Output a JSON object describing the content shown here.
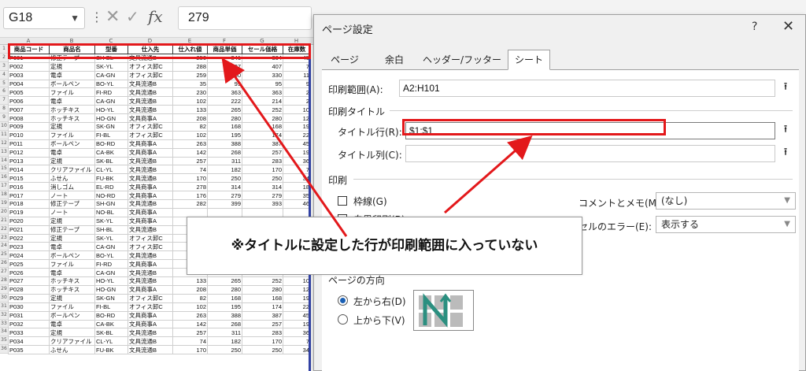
{
  "formula_bar": {
    "cell_ref": "G18",
    "value": "279",
    "fx": "fx"
  },
  "sheet": {
    "columns": [
      "A",
      "B",
      "C",
      "D",
      "E",
      "F",
      "G",
      "H"
    ],
    "headers": [
      "商品コード",
      "商品名",
      "型番",
      "仕入先",
      "仕入れ値",
      "商品単価",
      "セール価格",
      "在庫数"
    ],
    "rows": [
      [
        "P001",
        "修正テープ",
        "SH-BL",
        "文具流通B",
        "250",
        "341",
        "304",
        "45"
      ],
      [
        "P002",
        "定規",
        "SK-YL",
        "オフィス卸C",
        "288",
        "407",
        "407",
        "7"
      ],
      [
        "P003",
        "電卓",
        "CA-GN",
        "オフィス卸C",
        "259",
        "330",
        "330",
        "11"
      ],
      [
        "P004",
        "ボールペン",
        "BO-YL",
        "文具流通B",
        "35",
        "95",
        "95",
        "9"
      ],
      [
        "P005",
        "ファイル",
        "FI-RD",
        "文具流通B",
        "230",
        "363",
        "363",
        "2"
      ],
      [
        "P006",
        "電卓",
        "CA-GN",
        "文具流通B",
        "102",
        "222",
        "214",
        "2"
      ],
      [
        "P007",
        "ホッチキス",
        "HO-YL",
        "文具流通B",
        "133",
        "265",
        "252",
        "10"
      ],
      [
        "P008",
        "ホッチキス",
        "HO-GN",
        "文具商事A",
        "208",
        "280",
        "280",
        "12"
      ],
      [
        "P009",
        "定規",
        "SK-GN",
        "オフィス卸C",
        "82",
        "168",
        "168",
        "19"
      ],
      [
        "P010",
        "ファイル",
        "FI-BL",
        "オフィス卸C",
        "102",
        "195",
        "174",
        "22"
      ],
      [
        "P011",
        "ボールペン",
        "BO-RD",
        "文具商事A",
        "263",
        "388",
        "387",
        "45"
      ],
      [
        "P012",
        "電卓",
        "CA-BK",
        "文具商事A",
        "142",
        "268",
        "257",
        "19"
      ],
      [
        "P013",
        "定規",
        "SK-BL",
        "文具流通B",
        "257",
        "311",
        "283",
        "36"
      ],
      [
        "P014",
        "クリアファイル",
        "CL-YL",
        "文具流通B",
        "74",
        "182",
        "170",
        "7"
      ],
      [
        "P015",
        "ふせん",
        "FU-BK",
        "文具流通B",
        "170",
        "250",
        "250",
        "34"
      ],
      [
        "P016",
        "消しゴム",
        "EL-RD",
        "文具商事A",
        "278",
        "314",
        "314",
        "18"
      ],
      [
        "P017",
        "ノート",
        "NO-RD",
        "文具商事A",
        "176",
        "279",
        "279",
        "35"
      ],
      [
        "P018",
        "修正テープ",
        "SH-GN",
        "文具流通B",
        "282",
        "399",
        "393",
        "46"
      ],
      [
        "P019",
        "ノート",
        "NO-BL",
        "文具商事A",
        "",
        "",
        "",
        ""
      ],
      [
        "P020",
        "定規",
        "SK-YL",
        "文具商事A",
        "",
        "",
        "",
        ""
      ],
      [
        "P021",
        "修正テープ",
        "SH-BL",
        "文具流通B",
        "",
        "",
        "",
        ""
      ],
      [
        "P022",
        "定規",
        "SK-YL",
        "オフィス卸C",
        "",
        "",
        "",
        ""
      ],
      [
        "P023",
        "電卓",
        "CA-GN",
        "オフィス卸C",
        "",
        "",
        "",
        ""
      ],
      [
        "P024",
        "ボールペン",
        "BO-YL",
        "文具流通B",
        "",
        "",
        "",
        ""
      ],
      [
        "P025",
        "ファイル",
        "FI-RD",
        "文具商事A",
        "",
        "",
        "",
        ""
      ],
      [
        "P026",
        "電卓",
        "CA-GN",
        "文具流通B",
        "102",
        "222",
        "214",
        "2"
      ],
      [
        "P027",
        "ホッチキス",
        "HO-YL",
        "文具流通B",
        "133",
        "265",
        "252",
        "10"
      ],
      [
        "P028",
        "ホッチキス",
        "HO-GN",
        "文具商事A",
        "208",
        "280",
        "280",
        "12"
      ],
      [
        "P029",
        "定規",
        "SK-GN",
        "オフィス卸C",
        "82",
        "168",
        "168",
        "19"
      ],
      [
        "P030",
        "ファイル",
        "FI-BL",
        "オフィス卸C",
        "102",
        "195",
        "174",
        "22"
      ],
      [
        "P031",
        "ボールペン",
        "BO-RD",
        "文具商事A",
        "263",
        "388",
        "387",
        "45"
      ],
      [
        "P032",
        "電卓",
        "CA-BK",
        "文具商事A",
        "142",
        "268",
        "257",
        "19"
      ],
      [
        "P033",
        "定規",
        "SK-BL",
        "文具流通B",
        "257",
        "311",
        "283",
        "36"
      ],
      [
        "P034",
        "クリアファイル",
        "CL-YL",
        "文具流通B",
        "74",
        "182",
        "170",
        "7"
      ],
      [
        "P035",
        "ふせん",
        "FU-BK",
        "文具流通B",
        "170",
        "250",
        "250",
        "34"
      ]
    ]
  },
  "dialog": {
    "title": "ページ設定",
    "help": "?",
    "close": "✕",
    "tabs": [
      "ページ",
      "余白",
      "ヘッダー/フッター",
      "シート"
    ],
    "print_area_label": "印刷範囲(A):",
    "print_area_value": "A2:H101",
    "print_titles_section": "印刷タイトル",
    "title_rows_label": "タイトル行(R):",
    "title_rows_value": "$1:$1",
    "title_cols_label": "タイトル列(C):",
    "title_cols_value": "",
    "print_section": "印刷",
    "gridlines_label": "枠線(G)",
    "bw_label": "白黒印刷(B)",
    "comments_label": "コメントとメモ(M):",
    "comments_value": "(なし)",
    "errors_label": "セルのエラー(E):",
    "errors_value": "表示する",
    "page_order_section": "ページの方向",
    "order_left_right": "左から右(D)",
    "order_top_bottom": "上から下(V)",
    "collapse_icon": "⭱"
  },
  "callout": {
    "text": "※タイトルに設定した行が印刷範囲に入っていない"
  },
  "colors": {
    "annotation_red": "#e3181b",
    "print_border": "#3344aa"
  }
}
